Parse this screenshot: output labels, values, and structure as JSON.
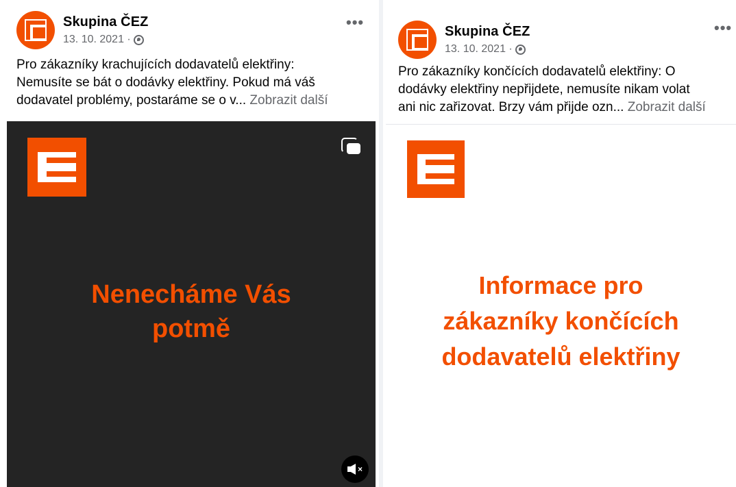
{
  "posts": [
    {
      "page_name": "Skupina ČEZ",
      "date": "13. 10. 2021 ·",
      "more_label": "•••",
      "text_lines": [
        "Pro zákazníky krachujících dodavatelů elektřiny:",
        "Nemusíte se bát o dodávky elektřiny. Pokud má váš",
        "dodavatel problémy, postaráme se o v..."
      ],
      "see_more": "Zobrazit další",
      "headline_lines": [
        "Nenecháme Vás",
        "potmě"
      ],
      "media_type": "video",
      "mute_label": "×"
    },
    {
      "page_name": "Skupina ČEZ",
      "date": "13. 10. 2021 ·",
      "more_label": "•••",
      "text_lines": [
        "Pro zákazníky končících dodavatelů elektřiny: O",
        "dodávky elektřiny nepřijdete, nemusíte nikam volat",
        "ani nic zařizovat. Brzy vám přijde ozn..."
      ],
      "see_more": "Zobrazit další",
      "headline_lines": [
        "Informace pro",
        "zákazníky končících",
        "dodavatelů elektřiny"
      ],
      "media_type": "image"
    }
  ],
  "colors": {
    "brand_orange": "#f24f00",
    "video_background": "#242424",
    "secondary_text": "#65676b"
  },
  "icons": [
    "globe-icon",
    "more-options-icon",
    "picture-in-picture-icon",
    "mute-icon"
  ]
}
